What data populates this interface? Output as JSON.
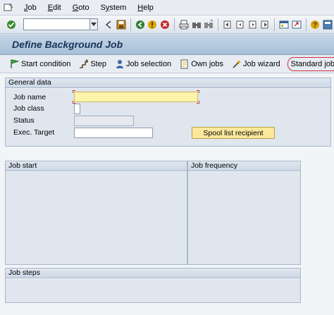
{
  "menubar": {
    "items": [
      {
        "prefix": "",
        "ul": "J",
        "rest": "ob"
      },
      {
        "prefix": "",
        "ul": "E",
        "rest": "dit"
      },
      {
        "prefix": "",
        "ul": "G",
        "rest": "oto"
      },
      {
        "prefix": "S",
        "ul": "y",
        "rest": "stem"
      },
      {
        "prefix": "",
        "ul": "H",
        "rest": "elp"
      }
    ]
  },
  "toolbar": {
    "command_field_value": ""
  },
  "titlebar": {
    "title": "Define Background Job"
  },
  "apptoolbar": {
    "buttons": [
      {
        "label": "Start condition",
        "icon": "start-condition-icon"
      },
      {
        "label": "Step",
        "icon": "step-icon"
      },
      {
        "label": "Job selection",
        "icon": "job-selection-icon"
      },
      {
        "label": "Own jobs",
        "icon": "own-jobs-icon"
      },
      {
        "label": "Job wizard",
        "icon": "job-wizard-icon"
      },
      {
        "label": "Standard jobs",
        "icon": ""
      }
    ]
  },
  "general": {
    "header": "General data",
    "job_name_label": "Job name",
    "job_name_value": "",
    "job_class_label": "Job class",
    "job_class_value": "",
    "status_label": "Status",
    "status_value": "",
    "exec_target_label": "Exec. Target",
    "exec_target_value": "",
    "spool_button": "Spool list recipient"
  },
  "job_start": {
    "header": "Job start"
  },
  "job_frequency": {
    "header": "Job frequency"
  },
  "job_steps": {
    "header": "Job steps"
  },
  "colors": {
    "title_text": "#18345a",
    "required_field": "#fdf3a9",
    "highlight_circle": "#d0303a",
    "spool_button_bg": "#fbe89c"
  }
}
